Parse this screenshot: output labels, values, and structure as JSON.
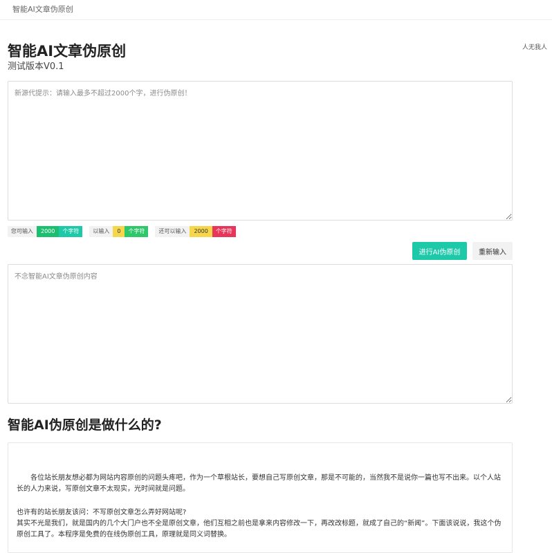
{
  "header": {
    "brand": "智能AI文章伪原创"
  },
  "side_note": "人无我人",
  "page": {
    "title": "智能AI文章伪原创",
    "version": "测试版本V0.1"
  },
  "input": {
    "placeholder": "新源代提示：请输入最多不超过2000个字，进行伪原创！",
    "value": ""
  },
  "counters": [
    {
      "label": "您可输入",
      "value": "2000",
      "unit": "个字符",
      "value_color": "#1dbe6f",
      "unit_color": "#1ec9a9",
      "value_text_color": "#ffffff"
    },
    {
      "label": "以输入",
      "value": "0",
      "unit": "个字符",
      "value_color": "#f6d64a",
      "unit_color": "#2ec76a",
      "value_text_color": "#333333"
    },
    {
      "label": "还可以输入",
      "value": "2000",
      "unit": "个字符",
      "value_color": "#f6d64a",
      "unit_color": "#e8355a",
      "value_text_color": "#333333"
    }
  ],
  "actions": {
    "submit_label": "进行AI伪原创",
    "reset_label": "重新输入",
    "accent": "#1ec9a9"
  },
  "output": {
    "placeholder": "不念智能AI文章伪原创内容",
    "value": ""
  },
  "about": {
    "title": "智能AI伪原创是做什么的?",
    "paragraphs": [
      "各位站长朋友想必都为网站内容原创的问题头疼吧，作为一个草根站长，要想自己写原创文章，那是不可能的，当然我不是说你一篇也写不出来。以个人站长的人力来说，写原创文章不太现实，光时间就是问题。",
      "也许有的站长朋友该问：不写原创文章怎么弄好网站呢?",
      "其实不光是我们，就是国内的几个大门户也不全是原创文章，他们互相之前也是拿来内容修改一下，再改改标题，就成了自己的“新闻”。下面该说说，我这个伪原创工具了。本程序是免费的在线伪原创工具，原理就是同义词替换。"
    ]
  }
}
